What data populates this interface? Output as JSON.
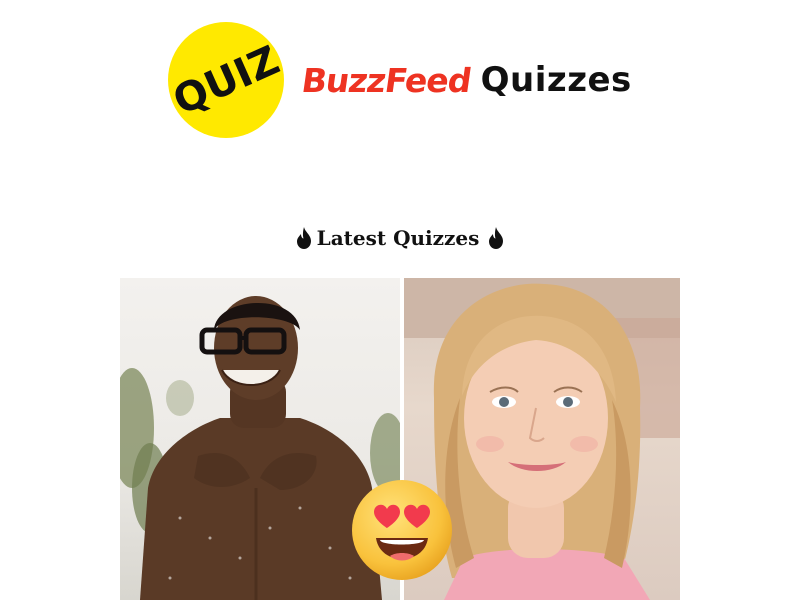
{
  "header": {
    "badge_text": "QUIZ",
    "brand_name": "BuzzFeed",
    "brand_suffix": "Quizzes"
  },
  "section": {
    "title": "Latest Quizzes"
  },
  "colors": {
    "badge_yellow": "#ffe900",
    "brand_red": "#ee3322",
    "text_dark": "#111111"
  },
  "quiz_card": {
    "left_image": "smiling-man-with-glasses-photo",
    "right_image": "smiling-blonde-woman-photo",
    "overlay_emoji": "heart-eyes-emoji"
  }
}
